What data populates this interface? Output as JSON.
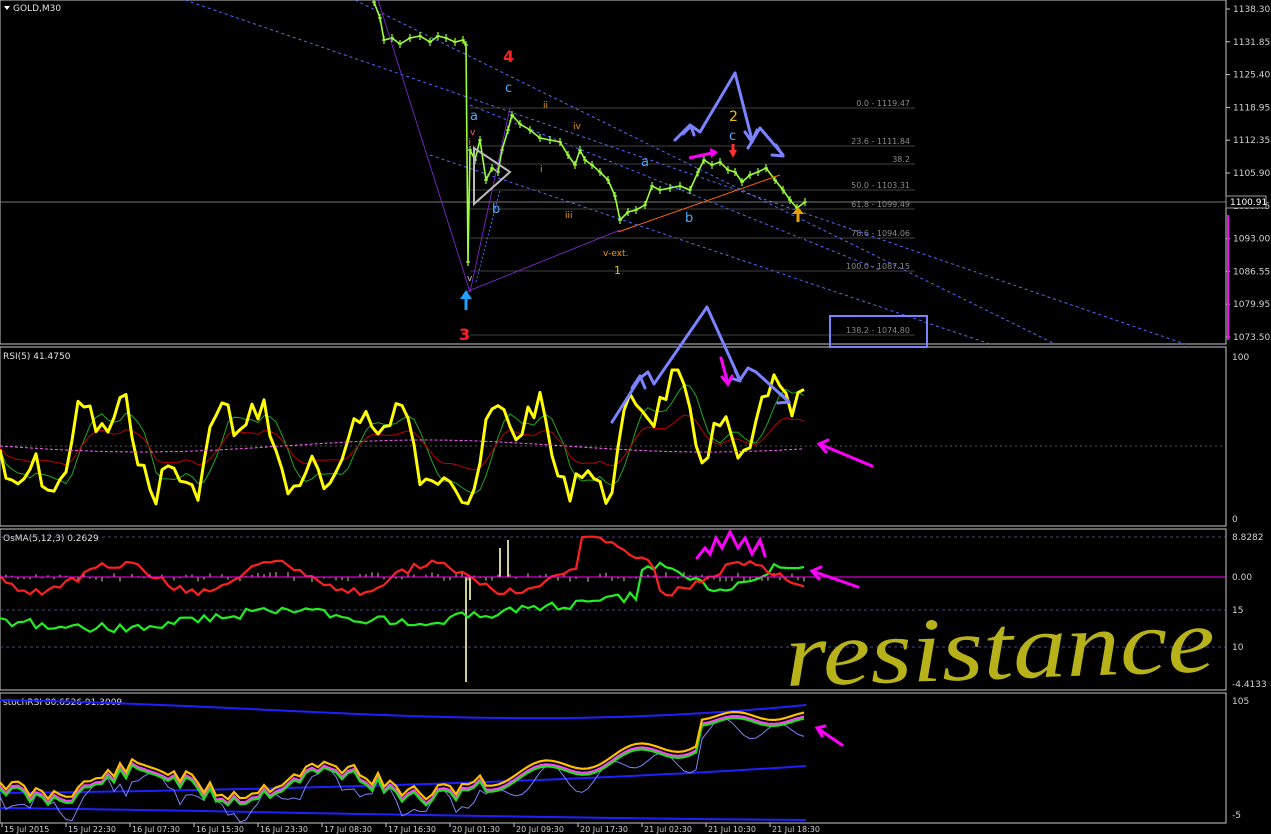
{
  "panels": {
    "main": {
      "title": "GOLD,M30",
      "price_labels": [
        "1138.30",
        "1131.85",
        "1125.40",
        "1118.95",
        "1112.35",
        "1105.90",
        "1099.45",
        "1093.00",
        "1086.55",
        "1079.95",
        "1073.50"
      ],
      "current_price": "1100.91"
    },
    "rsi": {
      "title": "RSI(5) 41.4750",
      "scale": [
        "100",
        "0"
      ]
    },
    "osma": {
      "title": "OsMA(5,12,3) 0.2629",
      "scale": [
        "8.8282",
        "0.00",
        "15",
        "10",
        "-4.4133"
      ]
    },
    "stoch": {
      "title": "stochRSI 80.6526 91.3009",
      "scale": [
        "105",
        "-5"
      ]
    }
  },
  "time_axis": [
    "15 Jul 2015",
    "15 Jul 22:30",
    "16 Jul 07:30",
    "16 Jul 15:30",
    "16 Jul 23:30",
    "17 Jul 08:30",
    "17 Jul 16:30",
    "20 Jul 01:30",
    "20 Jul 09:30",
    "20 Jul 17:30",
    "21 Jul 02:30",
    "21 Jul 10:30",
    "21 Jul 18:30"
  ],
  "fib_levels": [
    "0.0 - 1119.47",
    "23.6 - 1111.84",
    "38.2",
    "50.0 - 1103.31",
    "61.8 - 1099.49",
    "78.6 - 1094.06",
    "100.0 - 1087.15",
    "138.2 - 1074.80"
  ],
  "wave_labels": {
    "w4": "4",
    "w3": "3",
    "w2": "2",
    "w1": "1",
    "c1": "c",
    "a1": "a",
    "b1": "b",
    "a2": "a",
    "b2": "b",
    "c2": "c",
    "ii": "ii",
    "iv": "iv",
    "i": "i",
    "iii": "iii",
    "v_ext": "v-ext.",
    "v1": "v",
    "v2": "v",
    "ii2": "ii"
  },
  "annotation": "resistance",
  "colors": {
    "bg": "#000000",
    "candle": "#9cff3a",
    "rsi_line": "#ffff00",
    "magenta": "#ff00ff",
    "blue_arrow": "#7b82ff",
    "channel": "#4f6cff",
    "fib": "#6b6b6b",
    "scale_text": "#d0d0d0",
    "resistance": "#b8b21a"
  }
}
